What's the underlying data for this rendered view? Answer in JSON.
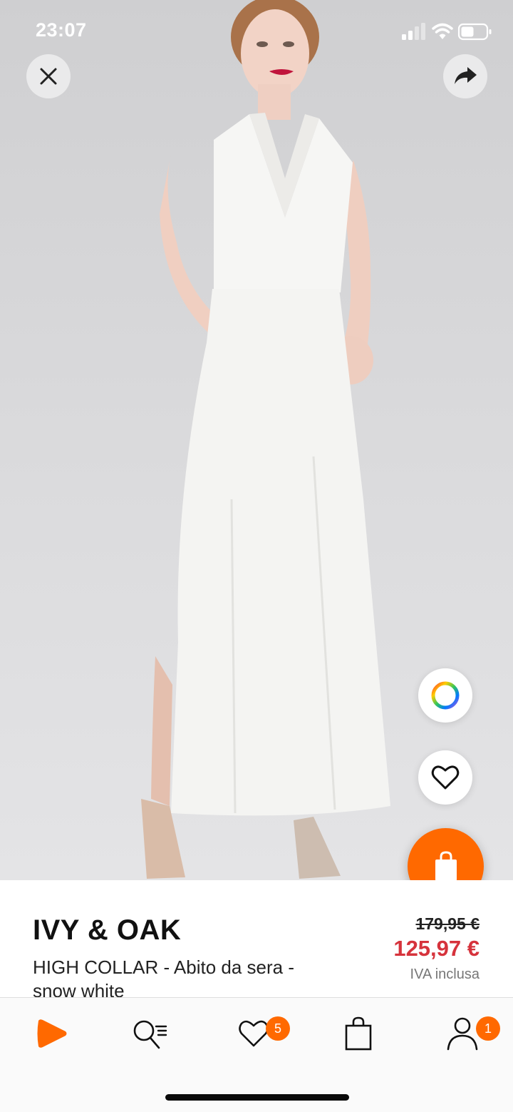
{
  "status_bar": {
    "time": "23:07"
  },
  "product": {
    "brand": "IVY & OAK",
    "name": "HIGH COLLAR - Abito da sera -\nsnow white",
    "old_price": "179,95 €",
    "sale_price": "125,97 €",
    "tax_note": "IVA inclusa"
  },
  "tabbar": {
    "wishlist_count": "5",
    "account_count": "1"
  },
  "colors": {
    "accent": "#ff6900",
    "sale": "#d6333c",
    "background": "#ffffff"
  },
  "icons": {
    "close": "close-icon",
    "share": "share-arrow-icon",
    "color_picker": "color-wheel-icon",
    "wishlist": "heart-icon",
    "add_to_cart": "shopping-bag-icon",
    "home": "zalando-logo-icon",
    "search": "search-list-icon",
    "cart": "bag-icon",
    "account": "person-icon"
  }
}
